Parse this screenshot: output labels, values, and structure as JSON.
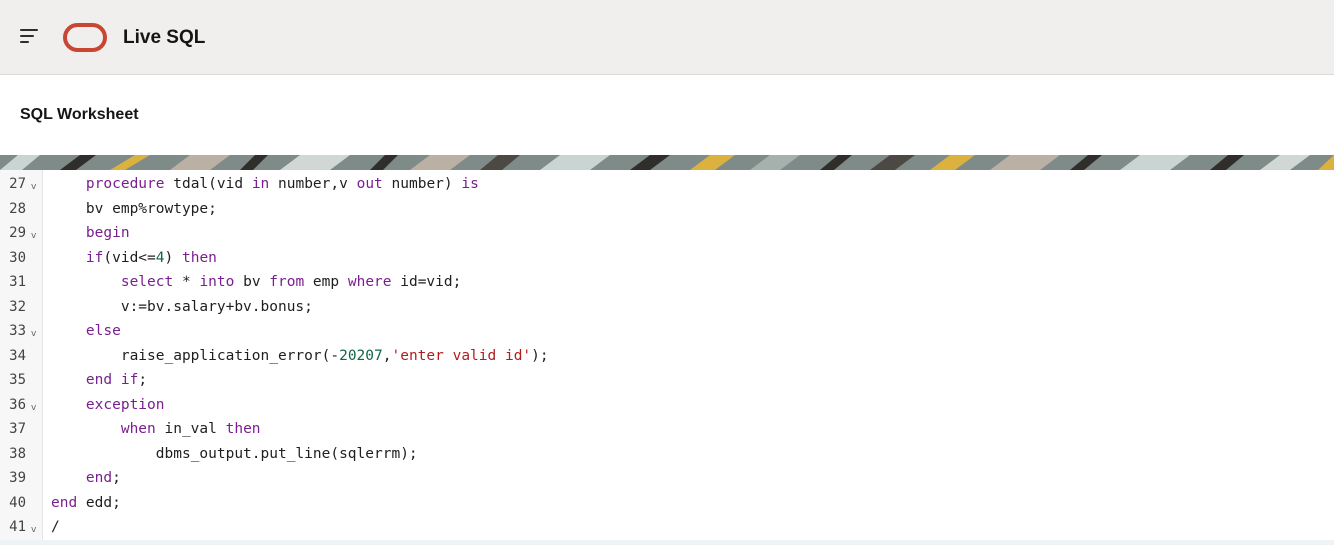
{
  "header": {
    "menu_icon": "hamburger-menu-icon",
    "logo_icon": "oracle-logo-icon",
    "brand_color": "#c74634",
    "title": "Live SQL"
  },
  "page": {
    "title": "SQL Worksheet"
  },
  "editor": {
    "lines": [
      {
        "num": "27",
        "fold": true,
        "tokens": [
          [
            "txt",
            "    "
          ],
          [
            "kw",
            "procedure"
          ],
          [
            "txt",
            " tdal(vid "
          ],
          [
            "kw",
            "in"
          ],
          [
            "txt",
            " number,v "
          ],
          [
            "kw",
            "out"
          ],
          [
            "txt",
            " number) "
          ],
          [
            "kw",
            "is"
          ]
        ]
      },
      {
        "num": "28",
        "fold": false,
        "tokens": [
          [
            "txt",
            "    bv emp%rowtype;"
          ]
        ]
      },
      {
        "num": "29",
        "fold": true,
        "tokens": [
          [
            "txt",
            "    "
          ],
          [
            "kw",
            "begin"
          ]
        ]
      },
      {
        "num": "30",
        "fold": false,
        "tokens": [
          [
            "txt",
            "    "
          ],
          [
            "kw",
            "if"
          ],
          [
            "txt",
            "(vid<="
          ],
          [
            "num",
            "4"
          ],
          [
            "txt",
            ") "
          ],
          [
            "kw",
            "then"
          ]
        ]
      },
      {
        "num": "31",
        "fold": false,
        "tokens": [
          [
            "txt",
            "        "
          ],
          [
            "kw",
            "select"
          ],
          [
            "txt",
            " * "
          ],
          [
            "kw",
            "into"
          ],
          [
            "txt",
            " bv "
          ],
          [
            "kw",
            "from"
          ],
          [
            "txt",
            " emp "
          ],
          [
            "kw",
            "where"
          ],
          [
            "txt",
            " id=vid;"
          ]
        ]
      },
      {
        "num": "32",
        "fold": false,
        "tokens": [
          [
            "txt",
            "        v:=bv.salary+bv.bonus;"
          ]
        ]
      },
      {
        "num": "33",
        "fold": true,
        "tokens": [
          [
            "txt",
            "    "
          ],
          [
            "kw",
            "else"
          ]
        ]
      },
      {
        "num": "34",
        "fold": false,
        "tokens": [
          [
            "txt",
            "        raise_application_error(-"
          ],
          [
            "num",
            "20207"
          ],
          [
            "txt",
            ","
          ],
          [
            "str",
            "'enter valid id'"
          ],
          [
            "txt",
            ");"
          ]
        ]
      },
      {
        "num": "35",
        "fold": false,
        "tokens": [
          [
            "txt",
            "    "
          ],
          [
            "kw",
            "end if"
          ],
          [
            "txt",
            ";"
          ]
        ]
      },
      {
        "num": "36",
        "fold": true,
        "tokens": [
          [
            "txt",
            "    "
          ],
          [
            "kw",
            "exception"
          ]
        ]
      },
      {
        "num": "37",
        "fold": false,
        "tokens": [
          [
            "txt",
            "        "
          ],
          [
            "kw",
            "when"
          ],
          [
            "txt",
            " in_val "
          ],
          [
            "kw",
            "then"
          ]
        ]
      },
      {
        "num": "38",
        "fold": false,
        "tokens": [
          [
            "txt",
            "            dbms_output.put_line(sqlerrm);"
          ]
        ]
      },
      {
        "num": "39",
        "fold": false,
        "tokens": [
          [
            "txt",
            "    "
          ],
          [
            "kw",
            "end"
          ],
          [
            "txt",
            ";"
          ]
        ]
      },
      {
        "num": "40",
        "fold": false,
        "tokens": [
          [
            "kw",
            "end"
          ],
          [
            "txt",
            " edd;"
          ]
        ]
      },
      {
        "num": "41",
        "fold": true,
        "tokens": [
          [
            "txt",
            "/"
          ]
        ]
      }
    ],
    "fold_glyph": "v",
    "colors": {
      "keyword": "#7a1f8f",
      "number": "#116644",
      "string": "#b01d1d"
    }
  }
}
